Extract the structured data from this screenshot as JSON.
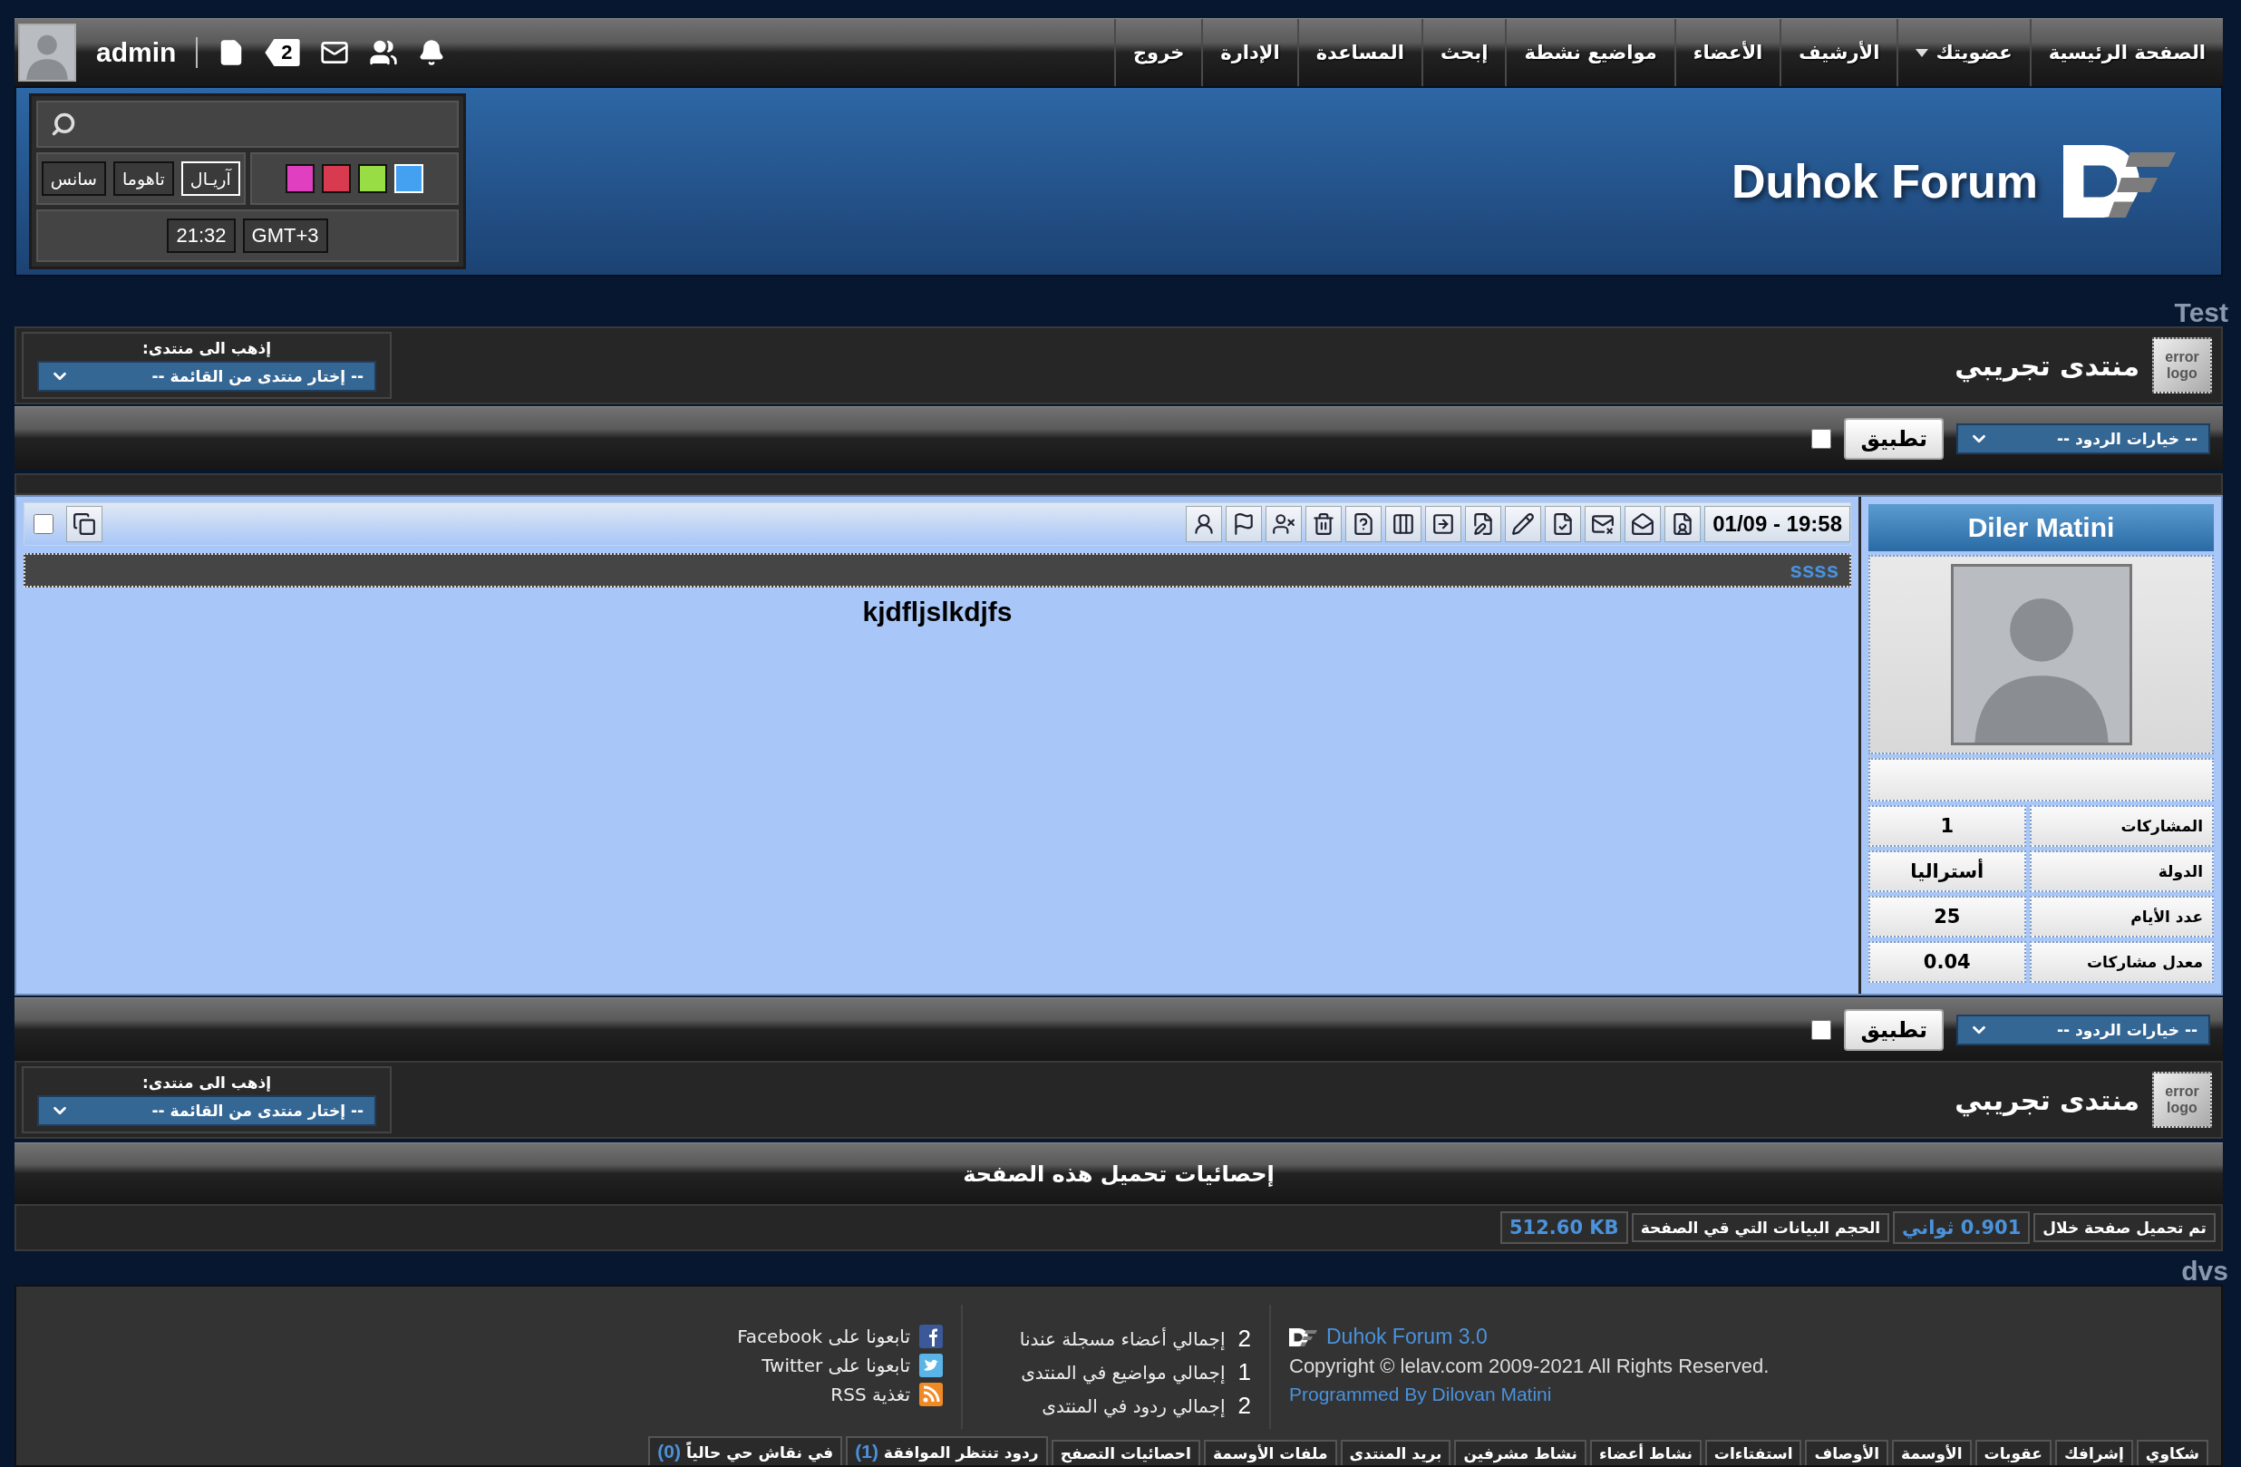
{
  "top_bar": {
    "user_name": "admin",
    "notification_count": "2",
    "nav": [
      {
        "label": "الصفحة الرئيسية",
        "dropdown": false
      },
      {
        "label": "عضويتك",
        "dropdown": true
      },
      {
        "label": "الأرشيف",
        "dropdown": false
      },
      {
        "label": "الأعضاء",
        "dropdown": false
      },
      {
        "label": "مواضيع نشطة",
        "dropdown": false
      },
      {
        "label": "إبحث",
        "dropdown": false
      },
      {
        "label": "المساعدة",
        "dropdown": false
      },
      {
        "label": "الإدارة",
        "dropdown": false
      },
      {
        "label": "خروج",
        "dropdown": false
      }
    ]
  },
  "header": {
    "logo_title": "Duhok Forum",
    "fonts": [
      {
        "label": "آريـال",
        "selected": true
      },
      {
        "label": "تاهوما",
        "selected": false
      },
      {
        "label": "سانس",
        "selected": false
      }
    ],
    "colors": [
      {
        "color": "#44a0f0",
        "selected": true
      },
      {
        "color": "#98dd44",
        "selected": false
      },
      {
        "color": "#d83a50",
        "selected": false
      },
      {
        "color": "#e040c0",
        "selected": false
      }
    ],
    "time": "21:32",
    "timezone": "GMT+3"
  },
  "test_label": "Test",
  "top_section": {
    "forum_title": "منتدى تجريبي",
    "error_logo": "error logo",
    "goto_label": "إذهب الى منتدى:",
    "goto_select": "-- إختار منتدى من القائمة --",
    "reply_options": "-- خيارات الردود --",
    "apply": "تطبيق",
    "checked": false
  },
  "post": {
    "date": "01/09 - 19:58",
    "title": "ssss",
    "body": "kjdfljslkdjfs",
    "checked": false,
    "author": {
      "name": "Diler Matini",
      "stats": [
        {
          "label": "المشاركات",
          "value": "1"
        },
        {
          "label": "الدولة",
          "value": "أستراليا"
        },
        {
          "label": "عدد الأيام",
          "value": "25"
        },
        {
          "label": "معدل مشاركات",
          "value": "0.04"
        }
      ]
    }
  },
  "bottom_section": {
    "forum_title": "منتدى تجريبي",
    "error_logo": "error logo",
    "goto_label": "إذهب الى منتدى:",
    "goto_select": "-- إختار منتدى من القائمة --",
    "reply_options": "-- خيارات الردود --",
    "apply": "تطبيق",
    "checked": false
  },
  "load_stats": {
    "title": "إحصائيات تحميل هذه الصفحة",
    "items": [
      {
        "label": "تم تحميل صفحة خلال",
        "value": "0.901 ثواني"
      },
      {
        "label": "الحجم البيانات التي قي الصفحة",
        "value": "512.60 KB"
      }
    ]
  },
  "dvs_label": "dvs",
  "footer": {
    "brand": "Duhok Forum 3.0",
    "copyright": "Copyright © lelav.com 2009-2021 All Rights Reserved.",
    "credit": "Programmed By Dilovan Matini",
    "totals": [
      {
        "count": "2",
        "label": "إجمالي أعضاء مسجلة عندنا"
      },
      {
        "count": "1",
        "label": "إجمالي مواضيع في المنتدى"
      },
      {
        "count": "2",
        "label": "إجمالي ردود في المنتدى"
      }
    ],
    "social": [
      {
        "kind": "facebook",
        "label": "تابعونا على Facebook"
      },
      {
        "kind": "twitter",
        "label": "تابعونا على Twitter"
      },
      {
        "kind": "rss",
        "label": "تغذية RSS"
      }
    ],
    "links": [
      {
        "label": "شكاوي"
      },
      {
        "label": "إشرافك"
      },
      {
        "label": "عقوبات"
      },
      {
        "label": "الأوسمة"
      },
      {
        "label": "الأوصاف"
      },
      {
        "label": "استفتاءات"
      },
      {
        "label": "نشاط أعضاء"
      },
      {
        "label": "نشاط مشرفين"
      },
      {
        "label": "بريد المنتدى"
      },
      {
        "label": "ملفات الأوسمة"
      },
      {
        "label": "احصائيات التصفح"
      },
      {
        "label": "ردود تنتظر الموافقة",
        "count": "(1)"
      },
      {
        "label": "في نقاش حي حالياً",
        "count": "(0)"
      }
    ]
  }
}
